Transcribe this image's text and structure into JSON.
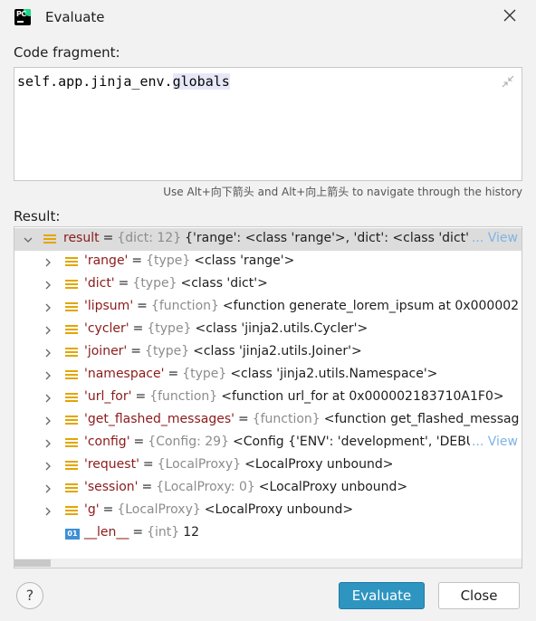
{
  "window": {
    "title": "Evaluate"
  },
  "code": {
    "label": "Code fragment:",
    "prefix": "self.app.jinja_env.",
    "highlighted": "globals",
    "hint": "Use Alt+向下箭头 and Alt+向上箭头 to navigate through the history"
  },
  "result": {
    "label": "Result:",
    "rows": [
      {
        "name": "result",
        "type": "{dict: 12}",
        "value": "{'range': <class 'range'>, 'dict': <class 'dict'>",
        "view": "... View",
        "expanded": true
      },
      {
        "name": "'range'",
        "type": "{type}",
        "value": "<class 'range'>"
      },
      {
        "name": "'dict'",
        "type": "{type}",
        "value": "<class 'dict'>"
      },
      {
        "name": "'lipsum'",
        "type": "{function}",
        "value": "<function generate_lorem_ipsum at 0x000002"
      },
      {
        "name": "'cycler'",
        "type": "{type}",
        "value": "<class 'jinja2.utils.Cycler'>"
      },
      {
        "name": "'joiner'",
        "type": "{type}",
        "value": "<class 'jinja2.utils.Joiner'>"
      },
      {
        "name": "'namespace'",
        "type": "{type}",
        "value": "<class 'jinja2.utils.Namespace'>"
      },
      {
        "name": "'url_for'",
        "type": "{function}",
        "value": "<function url_for at 0x000002183710A1F0>"
      },
      {
        "name": "'get_flashed_messages'",
        "type": "{function}",
        "value": "<function get_flashed_messag"
      },
      {
        "name": "'config'",
        "type": "{Config: 29}",
        "value": "<Config {'ENV': 'development', 'DEBU",
        "view": "... View"
      },
      {
        "name": "'request'",
        "type": "{LocalProxy}",
        "value": "<LocalProxy unbound>"
      },
      {
        "name": "'session'",
        "type": "{LocalProxy: 0}",
        "value": "<LocalProxy unbound>"
      },
      {
        "name": "'g'",
        "type": "{LocalProxy}",
        "value": "<LocalProxy unbound>"
      },
      {
        "name": "__len__",
        "type": "{int}",
        "value": "12",
        "icon": "int"
      }
    ]
  },
  "buttons": {
    "help": "?",
    "evaluate": "Evaluate",
    "close": "Close"
  },
  "icons": {
    "int_icon_text": "01"
  },
  "colors": {
    "accent": "#2e95c1",
    "name": "#8c1a1a",
    "type": "#8c8c8c",
    "field_icon": "#e2a600",
    "link": "#7fb3e6"
  }
}
